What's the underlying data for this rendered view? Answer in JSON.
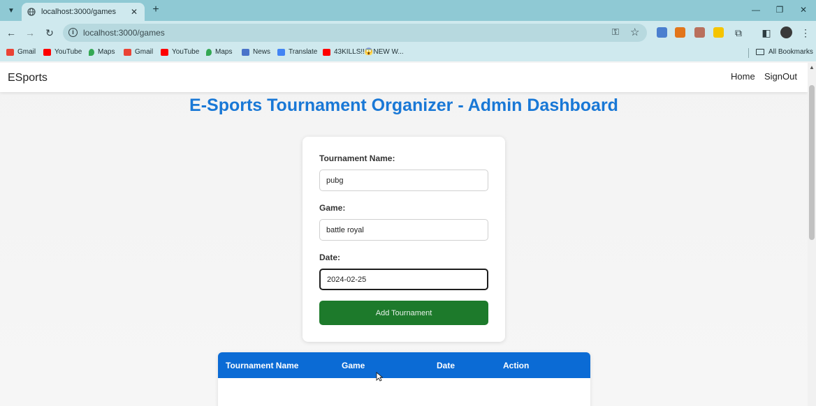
{
  "browser": {
    "tab_title": "localhost:3000/games",
    "url": "localhost:3000/games",
    "bookmarks": [
      "Gmail",
      "YouTube",
      "Maps",
      "Gmail",
      "YouTube",
      "Maps",
      "News",
      "Translate",
      "43KILLS!!😱NEW W..."
    ],
    "all_bookmarks": "All Bookmarks"
  },
  "navbar": {
    "brand": "ESports",
    "links": [
      "Home",
      "SignOut"
    ]
  },
  "page": {
    "heading": "E-Sports Tournament Organizer - Admin Dashboard"
  },
  "form": {
    "name_label": "Tournament Name:",
    "name_value": "pubg",
    "game_label": "Game:",
    "game_value": "battle royal",
    "date_label": "Date:",
    "date_value": "2024-02-25",
    "submit_label": "Add Tournament"
  },
  "table": {
    "headers": [
      "Tournament Name",
      "Game",
      "Date",
      "Action"
    ]
  },
  "colors": {
    "heading": "#1978d6",
    "table_header": "#0b6bd5",
    "submit": "#1d7a2b",
    "browser_frame": "#8fc9d4"
  }
}
